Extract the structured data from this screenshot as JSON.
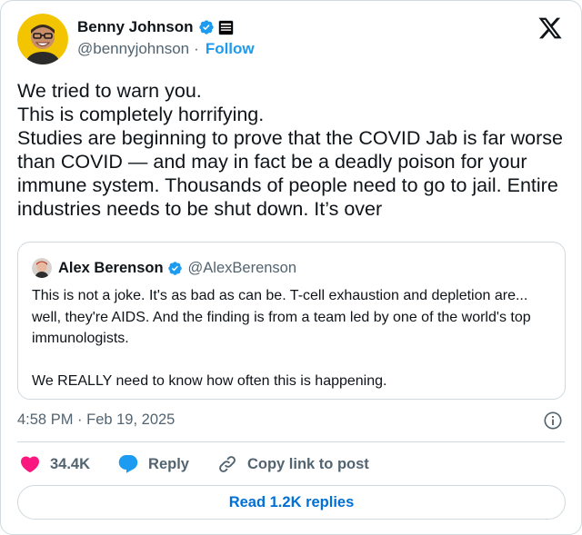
{
  "author": {
    "name": "Benny Johnson",
    "handle": "@bennyjohnson",
    "follow_label": "Follow",
    "separator": "·"
  },
  "tweet": {
    "text": "We tried to warn you.\nThis is completely horrifying.\nStudies are beginning to prove that the COVID Jab is far worse than COVID — and may in fact be a deadly poison for your immune system. Thousands of people need to go to jail. Entire industries needs to be shut down. It’s over"
  },
  "quote": {
    "name": "Alex Berenson",
    "handle": "@AlexBerenson",
    "text": "This is not a joke. It's as bad as can be. T-cell exhaustion and depletion are... well, they're AIDS. And the finding is from a team led by one of the world's top immunologists.\n\nWe REALLY need to know how often this is happening."
  },
  "meta": {
    "timestamp": "4:58 PM · Feb 19, 2025"
  },
  "actions": {
    "like_count": "34.4K",
    "reply_label": "Reply",
    "copy_label": "Copy link to post"
  },
  "read_replies": "Read 1.2K replies",
  "colors": {
    "accent": "#1d9bf0",
    "link": "#006fd6",
    "like": "#f91880",
    "muted": "#536471",
    "border": "#cfd9de",
    "text": "#0f1419"
  },
  "icons": {
    "verified": "verified-badge-icon",
    "affiliation": "affiliation-badge-icon",
    "logo": "x-logo-icon",
    "info": "info-icon",
    "like": "heart-icon",
    "reply": "speech-bubble-icon",
    "copy": "link-icon"
  }
}
